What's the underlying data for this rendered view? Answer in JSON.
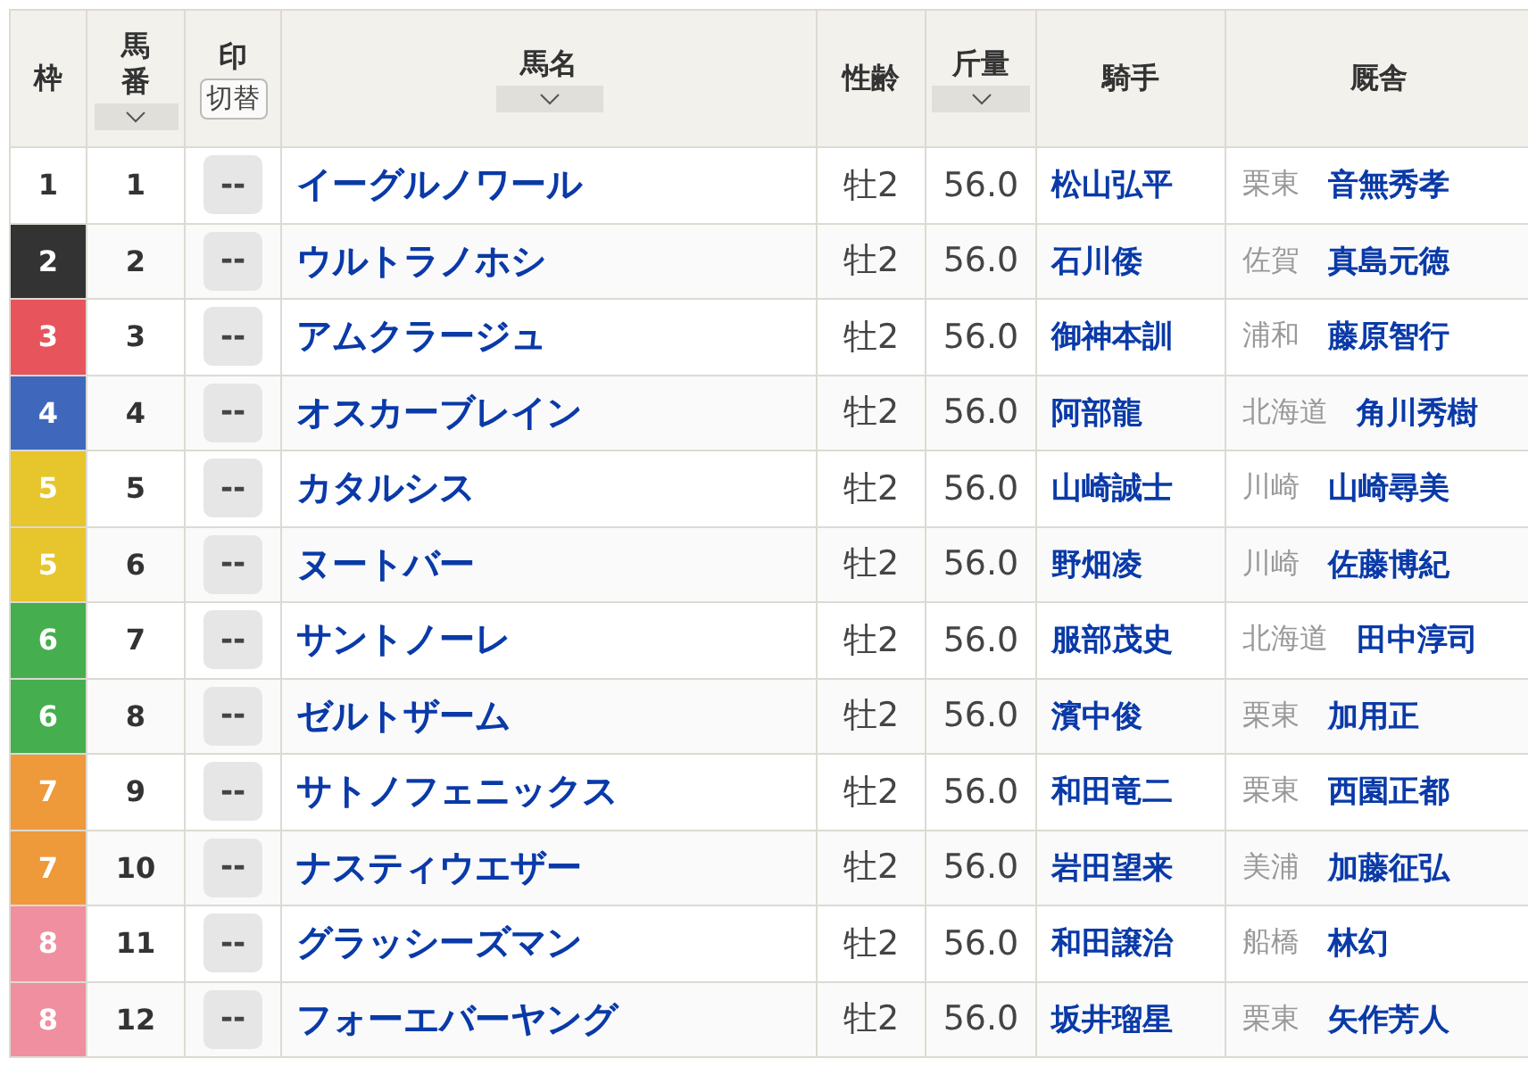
{
  "columns": [
    {
      "label": "枠",
      "sortable": false
    },
    {
      "label": "馬番",
      "sortable": true
    },
    {
      "label": "印",
      "sortable": false,
      "toggle": "切替"
    },
    {
      "label": "馬名",
      "sortable": true
    },
    {
      "label": "性齢",
      "sortable": false
    },
    {
      "label": "斤量",
      "sortable": true
    },
    {
      "label": "騎手",
      "sortable": false
    },
    {
      "label": "厩舎",
      "sortable": false
    }
  ],
  "rows": [
    {
      "frame": "1",
      "color": "#ffffff",
      "number": "1",
      "mark": "--",
      "horse": "イーグルノワール",
      "sex_age": "牡2",
      "weight": "56.0",
      "jockey": "松山弘平",
      "region": "栗東",
      "trainer": "音無秀孝"
    },
    {
      "frame": "2",
      "color": "#333333",
      "number": "2",
      "mark": "--",
      "horse": "ウルトラノホシ",
      "sex_age": "牡2",
      "weight": "56.0",
      "jockey": "石川倭",
      "region": "佐賀",
      "trainer": "真島元徳"
    },
    {
      "frame": "3",
      "color": "#e8545c",
      "number": "3",
      "mark": "--",
      "horse": "アムクラージュ",
      "sex_age": "牡2",
      "weight": "56.0",
      "jockey": "御神本訓",
      "region": "浦和",
      "trainer": "藤原智行"
    },
    {
      "frame": "4",
      "color": "#3f68bd",
      "number": "4",
      "mark": "--",
      "horse": "オスカーブレイン",
      "sex_age": "牡2",
      "weight": "56.0",
      "jockey": "阿部龍",
      "region": "北海道",
      "trainer": "角川秀樹"
    },
    {
      "frame": "5",
      "color": "#e7c52c",
      "number": "5",
      "mark": "--",
      "horse": "カタルシス",
      "sex_age": "牡2",
      "weight": "56.0",
      "jockey": "山崎誠士",
      "region": "川崎",
      "trainer": "山崎尋美"
    },
    {
      "frame": "5",
      "color": "#e7c52c",
      "number": "6",
      "mark": "--",
      "horse": "ヌートバー",
      "sex_age": "牡2",
      "weight": "56.0",
      "jockey": "野畑凌",
      "region": "川崎",
      "trainer": "佐藤博紀"
    },
    {
      "frame": "6",
      "color": "#45ae4e",
      "number": "7",
      "mark": "--",
      "horse": "サントノーレ",
      "sex_age": "牡2",
      "weight": "56.0",
      "jockey": "服部茂史",
      "region": "北海道",
      "trainer": "田中淳司"
    },
    {
      "frame": "6",
      "color": "#45ae4e",
      "number": "8",
      "mark": "--",
      "horse": "ゼルトザーム",
      "sex_age": "牡2",
      "weight": "56.0",
      "jockey": "濱中俊",
      "region": "栗東",
      "trainer": "加用正"
    },
    {
      "frame": "7",
      "color": "#ee993a",
      "number": "9",
      "mark": "--",
      "horse": "サトノフェニックス",
      "sex_age": "牡2",
      "weight": "56.0",
      "jockey": "和田竜二",
      "region": "栗東",
      "trainer": "西園正都"
    },
    {
      "frame": "7",
      "color": "#ee993a",
      "number": "10",
      "mark": "--",
      "horse": "ナスティウエザー",
      "sex_age": "牡2",
      "weight": "56.0",
      "jockey": "岩田望来",
      "region": "美浦",
      "trainer": "加藤征弘"
    },
    {
      "frame": "8",
      "color": "#ef8f9f",
      "number": "11",
      "mark": "--",
      "horse": "グラッシーズマン",
      "sex_age": "牡2",
      "weight": "56.0",
      "jockey": "和田譲治",
      "region": "船橋",
      "trainer": "林幻"
    },
    {
      "frame": "8",
      "color": "#ef8f9f",
      "number": "12",
      "mark": "--",
      "horse": "フォーエバーヤング",
      "sex_age": "牡2",
      "weight": "56.0",
      "jockey": "坂井瑠星",
      "region": "栗東",
      "trainer": "矢作芳人"
    }
  ]
}
